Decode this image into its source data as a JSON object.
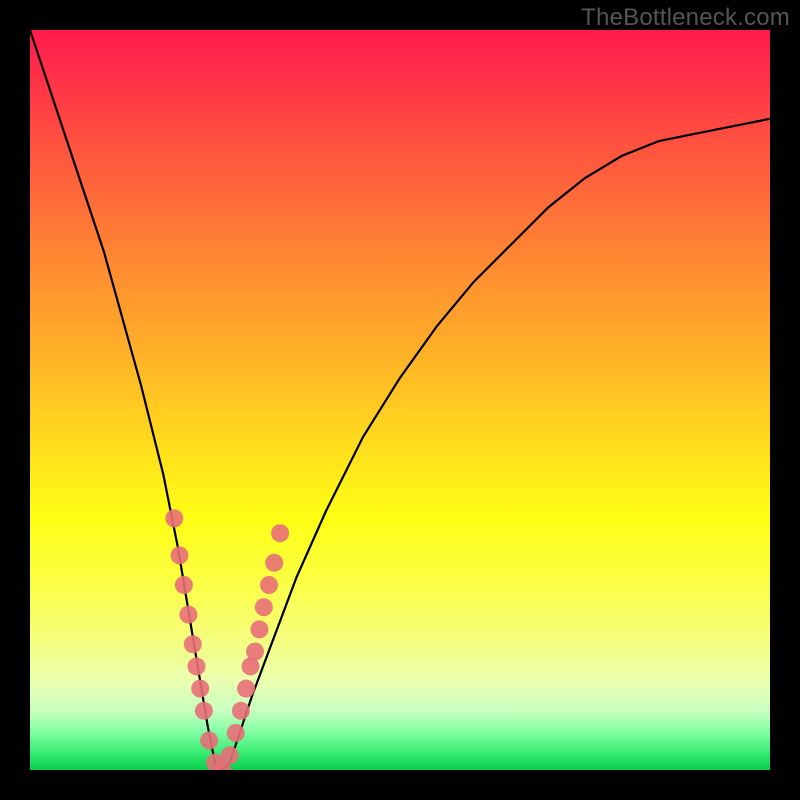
{
  "watermark": "TheBottleneck.com",
  "colors": {
    "gradient_top": "#ff1a4d",
    "gradient_mid": "#ffe31b",
    "gradient_bottom": "#08cc4a",
    "curve": "#000000",
    "marker": "#e86f78",
    "marker_stroke": "#7a2a30",
    "frame": "#000000",
    "watermark": "#555555"
  },
  "chart_data": {
    "type": "line",
    "title": "",
    "xlabel": "",
    "ylabel": "",
    "xlim": [
      0,
      100
    ],
    "ylim": [
      0,
      100
    ],
    "grid": false,
    "legend": false,
    "series": [
      {
        "name": "bottleneck-curve",
        "x": [
          0,
          5,
          10,
          15,
          18,
          20,
          22,
          24,
          25,
          26,
          27,
          28,
          30,
          33,
          36,
          40,
          45,
          50,
          55,
          60,
          65,
          70,
          75,
          80,
          85,
          90,
          95,
          100
        ],
        "y": [
          100,
          85,
          70,
          52,
          40,
          30,
          18,
          6,
          1,
          0,
          1,
          4,
          10,
          18,
          26,
          35,
          45,
          53,
          60,
          66,
          71,
          76,
          80,
          83,
          85,
          86,
          87,
          88
        ]
      }
    ],
    "markers": {
      "name": "highlight-points",
      "x": [
        19.5,
        20.2,
        20.8,
        21.4,
        22.0,
        22.5,
        23.0,
        23.5,
        24.2,
        25.0,
        26.0,
        27.0,
        27.8,
        28.5,
        29.2,
        29.8,
        30.4,
        31.0,
        31.6,
        32.3,
        33.0,
        33.8
      ],
      "y": [
        34,
        29,
        25,
        21,
        17,
        14,
        11,
        8,
        4,
        1,
        0,
        2,
        5,
        8,
        11,
        14,
        16,
        19,
        22,
        25,
        28,
        32
      ]
    },
    "optimum_x": 26,
    "background": "vertical-gradient red→yellow→green"
  }
}
